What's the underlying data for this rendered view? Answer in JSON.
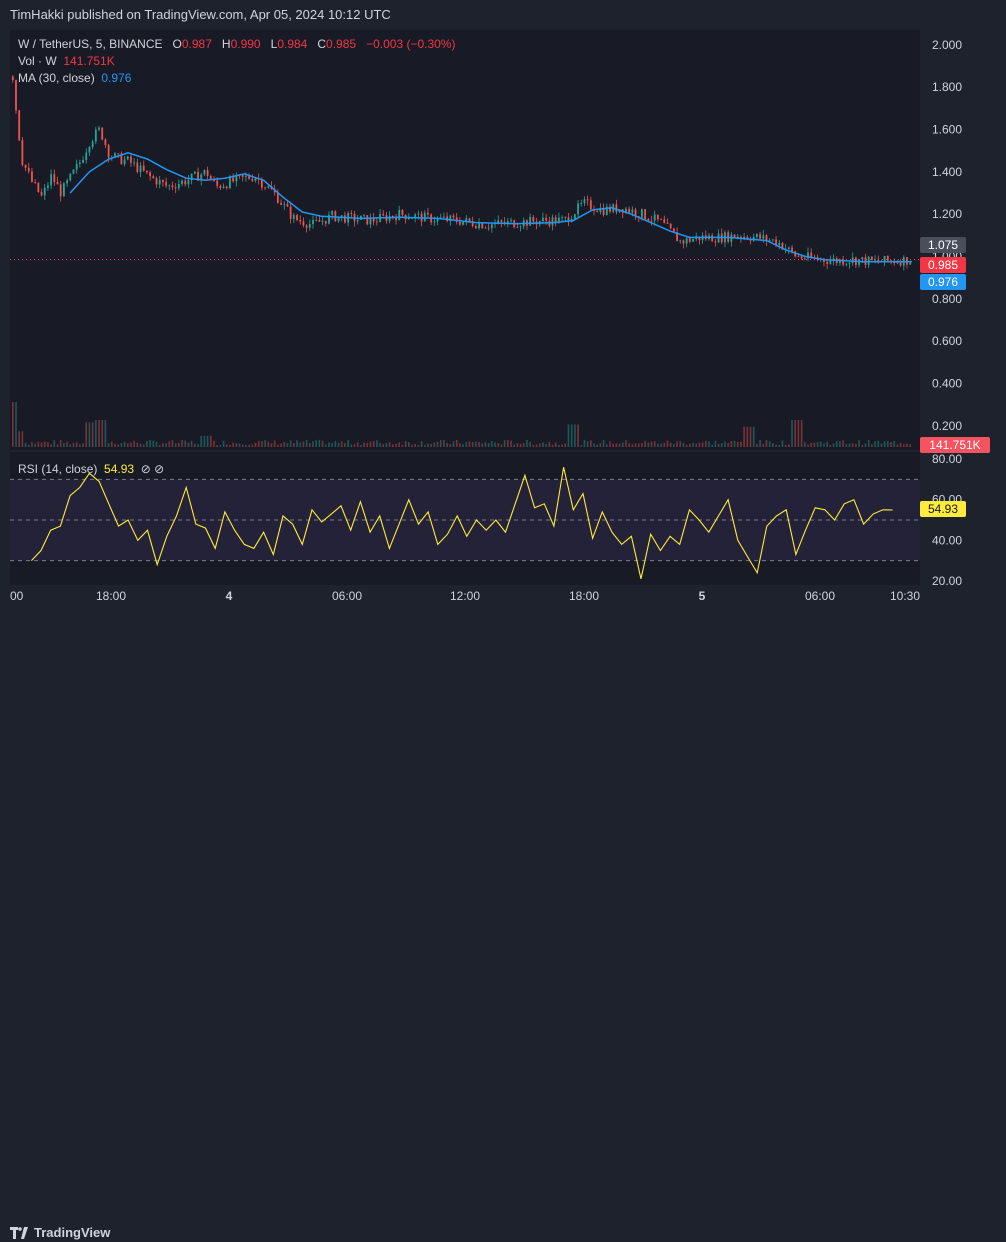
{
  "header": {
    "published": "TimHakki published on TradingView.com, Apr 05, 2024 10:12 UTC"
  },
  "legend": {
    "symbol": "W / TetherUS, 5, BINANCE",
    "o_label": "O",
    "o_value": "0.987",
    "h_label": "H",
    "h_value": "0.990",
    "l_label": "L",
    "l_value": "0.984",
    "c_label": "C",
    "c_value": "0.985",
    "change": "−0.003 (−0.30%)",
    "vol_label": "Vol · W",
    "vol_value": "141.751K",
    "ma_label": "MA (30, close)",
    "ma_value": "0.976",
    "rsi_label": "RSI (14, close)",
    "rsi_value": "54.93",
    "rsi_icons": "⊘ ⊘"
  },
  "tags": {
    "price_1075": "1.075",
    "price_close": "0.985",
    "price_ma": "0.976",
    "volume": "141.751K",
    "rsi": "54.93"
  },
  "colors": {
    "up": "#26a69a",
    "down": "#ef5350",
    "ma": "#2196f3",
    "rsi": "#ffeb3b",
    "rsi_band": "#7e57c2",
    "tag_grey": "#4a4e5a",
    "tag_red": "#f23645",
    "tag_blue": "#2196f3",
    "tag_volume": "#f7525f",
    "tag_yellow": "#ffeb3b"
  },
  "footer": {
    "brand": "TradingView",
    "logo_icon": "tradingview-logo-icon"
  },
  "chart_data": [
    {
      "type": "candlestick",
      "title": "W / TetherUS, 5, BINANCE",
      "y_ticks": [
        2.0,
        1.8,
        1.6,
        1.4,
        1.2,
        1.0,
        0.8,
        0.6,
        0.4,
        0.2
      ],
      "y_tick_labels": [
        "2.000",
        "1.800",
        "1.600",
        "1.400",
        "1.200",
        "1.000",
        "0.800",
        "0.600",
        "0.400",
        "0.200"
      ],
      "ylim": [
        0.1,
        2.07
      ],
      "x_tick_labels": [
        "00",
        "18:00",
        "4",
        "06:00",
        "12:00",
        "18:00",
        "5",
        "06:00",
        "10:30"
      ],
      "x_tick_days": [
        0,
        1,
        2,
        3,
        4,
        5,
        6,
        7,
        8
      ],
      "price_path": [
        [
          0,
          1.85
        ],
        [
          0.5,
          1.62
        ],
        [
          1,
          1.45
        ],
        [
          2,
          1.35
        ],
        [
          3,
          1.28
        ],
        [
          4,
          1.38
        ],
        [
          5,
          1.3
        ],
        [
          7,
          1.45
        ],
        [
          8,
          1.55
        ],
        [
          9,
          1.6
        ],
        [
          10,
          1.48
        ],
        [
          11,
          1.46
        ],
        [
          12,
          1.45
        ],
        [
          14,
          1.38
        ],
        [
          16,
          1.33
        ],
        [
          18,
          1.36
        ],
        [
          20,
          1.4
        ],
        [
          21,
          1.33
        ],
        [
          23,
          1.36
        ],
        [
          25,
          1.38
        ],
        [
          27,
          1.3
        ],
        [
          29,
          1.18
        ],
        [
          31,
          1.15
        ],
        [
          33,
          1.19
        ],
        [
          35,
          1.18
        ],
        [
          37,
          1.17
        ],
        [
          40,
          1.2
        ],
        [
          43,
          1.18
        ],
        [
          46,
          1.17
        ],
        [
          49,
          1.15
        ],
        [
          52,
          1.16
        ],
        [
          55,
          1.17
        ],
        [
          57,
          1.17
        ],
        [
          59,
          1.25
        ],
        [
          61,
          1.22
        ],
        [
          63,
          1.23
        ],
        [
          65,
          1.2
        ],
        [
          67,
          1.16
        ],
        [
          69,
          1.07
        ],
        [
          71,
          1.09
        ],
        [
          73,
          1.09
        ],
        [
          75,
          1.1
        ],
        [
          77,
          1.09
        ],
        [
          79,
          1.07
        ],
        [
          81,
          1.0
        ],
        [
          83,
          0.99
        ],
        [
          85,
          0.98
        ],
        [
          87,
          0.985
        ],
        [
          89,
          0.975
        ],
        [
          91,
          0.98
        ],
        [
          93,
          0.985
        ]
      ],
      "ma_path": [
        [
          6,
          1.3
        ],
        [
          8,
          1.4
        ],
        [
          10,
          1.46
        ],
        [
          12,
          1.49
        ],
        [
          14,
          1.46
        ],
        [
          16,
          1.41
        ],
        [
          18,
          1.37
        ],
        [
          20,
          1.36
        ],
        [
          22,
          1.37
        ],
        [
          24,
          1.39
        ],
        [
          26,
          1.36
        ],
        [
          28,
          1.28
        ],
        [
          30,
          1.21
        ],
        [
          32,
          1.19
        ],
        [
          36,
          1.18
        ],
        [
          40,
          1.185
        ],
        [
          44,
          1.18
        ],
        [
          48,
          1.16
        ],
        [
          52,
          1.155
        ],
        [
          56,
          1.16
        ],
        [
          58,
          1.17
        ],
        [
          60,
          1.22
        ],
        [
          62,
          1.23
        ],
        [
          64,
          1.2
        ],
        [
          66,
          1.16
        ],
        [
          68,
          1.12
        ],
        [
          70,
          1.09
        ],
        [
          74,
          1.09
        ],
        [
          78,
          1.075
        ],
        [
          80,
          1.03
        ],
        [
          82,
          1.0
        ],
        [
          84,
          0.985
        ],
        [
          88,
          0.975
        ],
        [
          93,
          0.976
        ]
      ],
      "last_close": 0.985,
      "ma_last": 0.976,
      "marked_level": 1.075
    },
    {
      "type": "bar",
      "title": "Vol · W",
      "last_value_label": "141.751K",
      "volume_spikes": [
        [
          0,
          1.0
        ],
        [
          0.5,
          0.35
        ],
        [
          8,
          0.55
        ],
        [
          9,
          0.6
        ],
        [
          20,
          0.25
        ],
        [
          58,
          0.5
        ],
        [
          76,
          0.45
        ],
        [
          81,
          0.6
        ]
      ]
    },
    {
      "type": "line",
      "title": "RSI (14, close)",
      "y_ticks": [
        80,
        60,
        40,
        20
      ],
      "y_tick_labels": [
        "80.00",
        "60.00",
        "40.00",
        "20.00"
      ],
      "ylim": [
        18,
        82
      ],
      "bands": [
        30,
        50,
        70
      ],
      "rsi_path": [
        [
          2,
          30
        ],
        [
          3,
          35
        ],
        [
          4,
          45
        ],
        [
          5,
          47
        ],
        [
          6,
          62
        ],
        [
          7,
          66
        ],
        [
          8,
          73
        ],
        [
          9,
          69
        ],
        [
          10,
          58
        ],
        [
          11,
          47
        ],
        [
          12,
          50
        ],
        [
          13,
          40
        ],
        [
          14,
          45
        ],
        [
          15,
          28
        ],
        [
          16,
          42
        ],
        [
          17,
          52
        ],
        [
          18,
          66
        ],
        [
          19,
          48
        ],
        [
          20,
          46
        ],
        [
          21,
          36
        ],
        [
          22,
          54
        ],
        [
          23,
          45
        ],
        [
          24,
          38
        ],
        [
          25,
          36
        ],
        [
          26,
          44
        ],
        [
          27,
          33
        ],
        [
          28,
          52
        ],
        [
          29,
          48
        ],
        [
          30,
          38
        ],
        [
          31,
          55
        ],
        [
          32,
          49
        ],
        [
          33,
          53
        ],
        [
          34,
          57
        ],
        [
          35,
          45
        ],
        [
          36,
          59
        ],
        [
          37,
          44
        ],
        [
          38,
          52
        ],
        [
          39,
          36
        ],
        [
          40,
          48
        ],
        [
          41,
          60
        ],
        [
          42,
          48
        ],
        [
          43,
          54
        ],
        [
          44,
          38
        ],
        [
          45,
          43
        ],
        [
          46,
          52
        ],
        [
          47,
          42
        ],
        [
          48,
          50
        ],
        [
          49,
          45
        ],
        [
          50,
          50
        ],
        [
          51,
          44
        ],
        [
          52,
          58
        ],
        [
          53,
          72
        ],
        [
          54,
          56
        ],
        [
          55,
          58
        ],
        [
          56,
          47
        ],
        [
          57,
          76
        ],
        [
          58,
          55
        ],
        [
          59,
          63
        ],
        [
          60,
          41
        ],
        [
          61,
          54
        ],
        [
          62,
          44
        ],
        [
          63,
          38
        ],
        [
          64,
          42
        ],
        [
          65,
          21
        ],
        [
          66,
          43
        ],
        [
          67,
          35
        ],
        [
          68,
          42
        ],
        [
          69,
          38
        ],
        [
          70,
          55
        ],
        [
          71,
          50
        ],
        [
          72,
          44
        ],
        [
          73,
          52
        ],
        [
          74,
          60
        ],
        [
          75,
          40
        ],
        [
          76,
          32
        ],
        [
          77,
          24
        ],
        [
          78,
          47
        ],
        [
          79,
          52
        ],
        [
          80,
          55
        ],
        [
          81,
          33
        ],
        [
          82,
          45
        ],
        [
          83,
          56
        ],
        [
          84,
          55
        ],
        [
          85,
          50
        ],
        [
          86,
          58
        ],
        [
          87,
          60
        ],
        [
          88,
          48
        ],
        [
          89,
          53
        ],
        [
          90,
          55
        ],
        [
          91,
          54.93
        ]
      ],
      "last_value": 54.93
    }
  ]
}
